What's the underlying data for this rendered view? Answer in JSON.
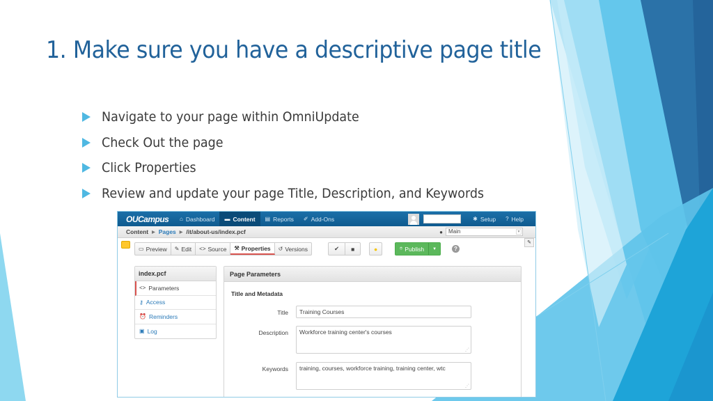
{
  "slide": {
    "title": "1. Make sure you have a descriptive page title",
    "bullets": [
      "Navigate to your page within OmniUpdate",
      "Check Out the page",
      "Click Properties",
      "Review and update your page Title, Description, and Keywords"
    ],
    "colors": {
      "title": "#21629a",
      "bullet_arrow": "#4fb8e2",
      "body_text": "#3a3a3a"
    }
  },
  "app": {
    "logo": "OUCampus",
    "nav": [
      {
        "label": "Dashboard",
        "icon": "home-icon"
      },
      {
        "label": "Content",
        "icon": "folder-icon",
        "active": true
      },
      {
        "label": "Reports",
        "icon": "clipboard-icon"
      },
      {
        "label": "Add-Ons",
        "icon": "pin-icon"
      }
    ],
    "nav_right": {
      "setup": "Setup",
      "help": "Help"
    },
    "breadcrumb": {
      "root": "Content",
      "pages": "Pages",
      "path": "/it/about-us/index.pcf"
    },
    "site_select": {
      "value": "Main"
    },
    "toolbar": {
      "tabs": [
        {
          "label": "Preview",
          "icon": "monitor-icon"
        },
        {
          "label": "Edit",
          "icon": "pencil-icon"
        },
        {
          "label": "Source",
          "icon": "code-icon"
        },
        {
          "label": "Properties",
          "icon": "tools-icon",
          "active": true
        },
        {
          "label": "Versions",
          "icon": "history-icon"
        }
      ],
      "publish": "Publish"
    },
    "side_panel": {
      "title": "index.pcf",
      "items": [
        {
          "label": "Parameters",
          "icon": "code-icon",
          "active": true
        },
        {
          "label": "Access",
          "icon": "key-icon"
        },
        {
          "label": "Reminders",
          "icon": "alarm-clock-icon"
        },
        {
          "label": "Log",
          "icon": "log-icon"
        }
      ]
    },
    "main_panel": {
      "title": "Page Parameters",
      "section": "Title and Metadata",
      "fields": {
        "title_label": "Title",
        "title_value": "Training Courses",
        "description_label": "Description",
        "description_value": "Workforce training center's courses",
        "keywords_label": "Keywords",
        "keywords_value": "training, courses, workforce training, training center, wtc"
      }
    }
  }
}
